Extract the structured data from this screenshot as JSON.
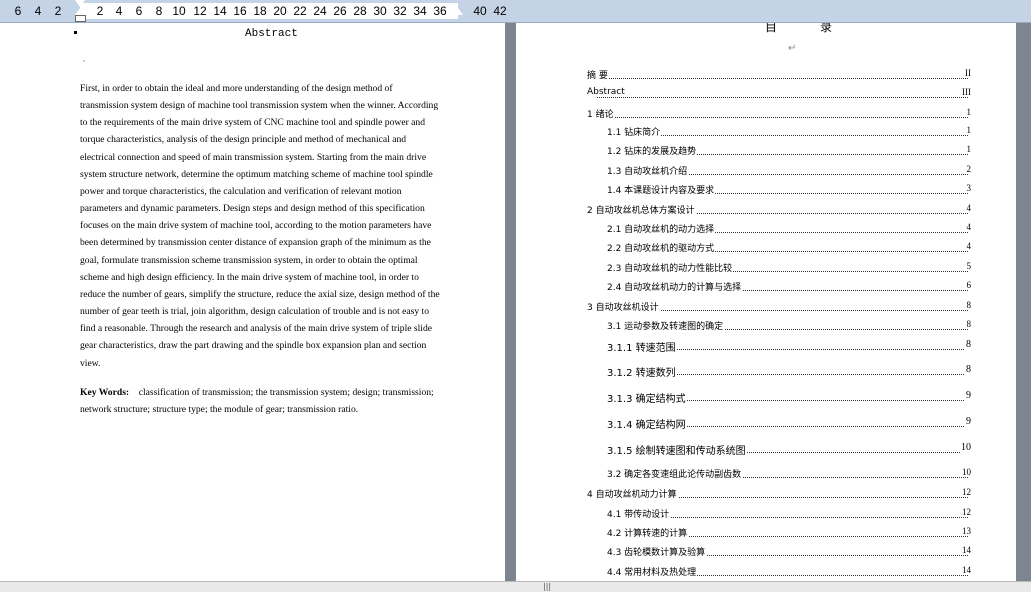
{
  "ruler": {
    "ticks": [
      "6",
      "4",
      "2",
      "2",
      "4",
      "6",
      "8",
      "10",
      "12",
      "14",
      "16",
      "18",
      "20",
      "22",
      "24",
      "26",
      "28",
      "30",
      "32",
      "34",
      "36",
      "40",
      "42"
    ]
  },
  "left_page": {
    "title": "Abstract",
    "body_lines": [
      "First, in order to obtain the ideal and more understanding of the design method of",
      "transmission system design of machine tool transmission system when the winner. According",
      "to the requirements of the main drive system of CNC machine tool and spindle power and",
      "torque characteristics, analysis of the design principle and method of mechanical and",
      "electrical connection and speed of main transmission system. Starting from the main drive",
      "system structure network, determine the optimum matching scheme of machine tool spindle",
      "power and torque characteristics, the calculation and verification of relevant motion",
      "parameters and dynamic parameters. Design steps and design method of this specification",
      "focuses on the main drive system of machine tool, according to the motion parameters have",
      "been determined by transmission center distance of expansion graph of the minimum as the",
      "goal, formulate transmission scheme transmission system, in order to obtain the optimal",
      "scheme and high design efficiency. In the main drive system of machine tool, in order to",
      "reduce the number of gears, simplify the structure, reduce the axial size, design method of the",
      "number of gear teeth is trial, join algorithm, design calculation of trouble and is not easy to",
      "find a reasonable. Through the research and analysis of the main drive system of triple slide",
      "gear characteristics, draw the part drawing and the spindle box expansion plan and section",
      "view."
    ],
    "keywords_label": "Key Words:",
    "keywords_line1": "classification of transmission; the transmission system; design; transmission;",
    "keywords_line2": "network structure; structure type; the module of gear; transmission ratio."
  },
  "right_page": {
    "toc_title": "目 录",
    "toc": [
      {
        "label": "摘 要",
        "page": "II",
        "indent": 0,
        "size": "s"
      },
      {
        "label": "Abstract",
        "page": "III",
        "indent": 0,
        "size": "s"
      },
      {
        "label": "1 绪论",
        "page": "1",
        "indent": 0,
        "size": "s"
      },
      {
        "label": "1.1 钻床简介",
        "page": "1",
        "indent": 1,
        "size": "s"
      },
      {
        "label": "1.2 钻床的发展及趋势",
        "page": "1",
        "indent": 1,
        "size": "s"
      },
      {
        "label": "1.3 自动攻丝机介绍",
        "page": "2",
        "indent": 1,
        "size": "s"
      },
      {
        "label": "1.4 本课题设计内容及要求",
        "page": "3",
        "indent": 1,
        "size": "s"
      },
      {
        "label": "2 自动攻丝机总体方案设计",
        "page": "4",
        "indent": 0,
        "size": "s"
      },
      {
        "label": "2.1 自动攻丝机的动力选择",
        "page": "4",
        "indent": 1,
        "size": "s"
      },
      {
        "label": "2.2 自动攻丝机的驱动方式",
        "page": "4",
        "indent": 1,
        "size": "s"
      },
      {
        "label": "2.3 自动攻丝机的动力性能比较",
        "page": "5",
        "indent": 1,
        "size": "s"
      },
      {
        "label": "2.4 自动攻丝机动力的计算与选择",
        "page": "6",
        "indent": 1,
        "size": "s"
      },
      {
        "label": "3 自动攻丝机设计",
        "page": "8",
        "indent": 0,
        "size": "s"
      },
      {
        "label": "3.1 运动参数及转速图的确定",
        "page": "8",
        "indent": 1,
        "size": "s"
      },
      {
        "label": "3.1.1 转速范围",
        "page": "8",
        "indent": 1,
        "size": "m"
      },
      {
        "label": "3.1.2 转速数列",
        "page": "8",
        "indent": 1,
        "size": "m"
      },
      {
        "label": "3.1.3 确定结构式",
        "page": "9",
        "indent": 1,
        "size": "m"
      },
      {
        "label": "3.1.4 确定结构网",
        "page": "9",
        "indent": 1,
        "size": "m"
      },
      {
        "label": "3.1.5 绘制转速图和传动系统图",
        "page": "10",
        "indent": 1,
        "size": "m"
      },
      {
        "label": "3.2 确定各变速组此论传动副齿数",
        "page": "10",
        "indent": 1,
        "size": "s"
      },
      {
        "label": "4 自动攻丝机动力计算",
        "page": "12",
        "indent": 0,
        "size": "s"
      },
      {
        "label": "4.1 带传动设计",
        "page": "12",
        "indent": 1,
        "size": "s"
      },
      {
        "label": "4.2 计算转速的计算",
        "page": "13",
        "indent": 1,
        "size": "s"
      },
      {
        "label": "4.3 齿轮模数计算及验算",
        "page": "14",
        "indent": 1,
        "size": "s"
      },
      {
        "label": "4.4 常用材料及热处理",
        "page": "14",
        "indent": 1,
        "size": "s"
      }
    ]
  },
  "colors": {
    "ruler_bg": "#c5d3e6",
    "workspace_bg": "#7d8591",
    "page_bg": "#ffffff"
  }
}
